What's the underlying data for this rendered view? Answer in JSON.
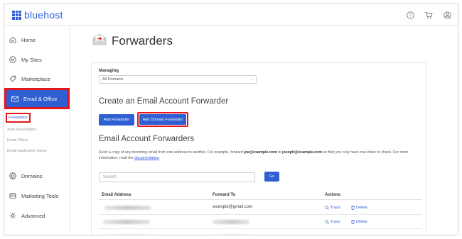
{
  "brand": {
    "name": "bluehost",
    "color": "#2f5fd3"
  },
  "topbar": {
    "icons": [
      "help-icon",
      "cart-icon",
      "account-icon"
    ]
  },
  "sidebar": {
    "items": [
      {
        "label": "Home",
        "icon": "home-icon"
      },
      {
        "label": "My Sites",
        "icon": "wordpress-icon"
      },
      {
        "label": "Marketplace",
        "icon": "tag-icon"
      },
      {
        "label": "Email & Office",
        "icon": "mail-icon",
        "active": true
      },
      {
        "label": "Domains",
        "icon": "globe-icon"
      },
      {
        "label": "Marketing Tools",
        "icon": "tools-icon"
      },
      {
        "label": "Advanced",
        "icon": "gear-icon"
      }
    ],
    "subitems": [
      {
        "label": "Forwarders",
        "active": true
      },
      {
        "label": "Auto Responders"
      },
      {
        "label": "Email Filters"
      },
      {
        "label": "Email Application Setup"
      }
    ]
  },
  "main": {
    "title": "Forwarders",
    "managing_label": "Managing",
    "managing_value": "All Domains",
    "create_heading": "Create an Email Account Forwarder",
    "add_forwarder_label": "Add Forwarder",
    "add_domain_forwarder_label": "Add Domain Forwarder",
    "forwarders_heading": "Email Account Forwarders",
    "description": {
      "part1": "Send a copy of any incoming email from one address to another. For example, forward ",
      "email1": "joe@example.com",
      "part2": " to ",
      "email2": "joseph@example.com",
      "part3": " so that you only have one inbox to check. For more information, read the ",
      "link": "documentation",
      "part4": "."
    },
    "search_placeholder": "Search",
    "go_label": "Go",
    "table": {
      "headers": [
        "Email Address",
        "Forward To",
        "Actions"
      ],
      "rows": [
        {
          "email": "",
          "forward_to": "example@gmail.com"
        },
        {
          "email": "",
          "forward_to": ""
        },
        {
          "email": "",
          "forward_to": ""
        }
      ],
      "trace_label": "Trace",
      "delete_label": "Delete"
    }
  }
}
